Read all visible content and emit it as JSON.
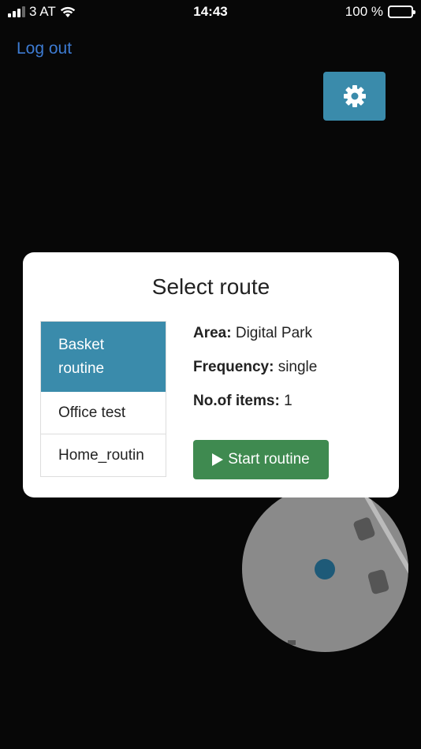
{
  "status_bar": {
    "carrier": "3 AT",
    "time": "14:43",
    "battery": "100 %",
    "battery_level": 1.0
  },
  "header": {
    "logout_label": "Log out",
    "settings_icon": "gear-icon"
  },
  "modal": {
    "title": "Select route",
    "routes": [
      {
        "label": "Basket routine",
        "selected": true
      },
      {
        "label": "Office test",
        "selected": false
      },
      {
        "label": "Home_routin",
        "selected": false
      }
    ],
    "details": {
      "area_label": "Area:",
      "area_value": "Digital Park",
      "frequency_label": "Frequency:",
      "frequency_value": "single",
      "items_label": "No.of items:",
      "items_value": "1"
    },
    "start_button": "Start routine"
  },
  "colors": {
    "accent": "#3a8bab",
    "start_button": "#3f8a50",
    "link": "#3d7bd2",
    "background": "#070707"
  }
}
